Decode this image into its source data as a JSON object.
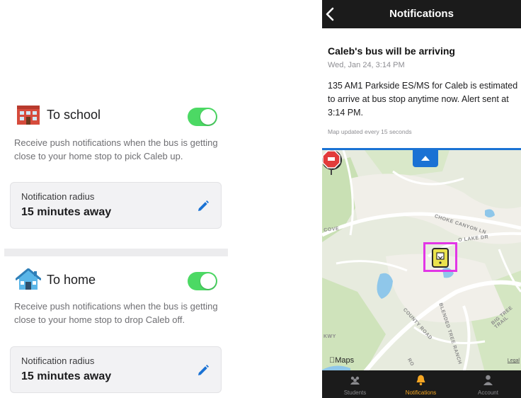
{
  "settings": {
    "to_school": {
      "title": "To school",
      "enabled": true,
      "description": "Receive push notifications when the bus is getting close to your home stop to pick Caleb up.",
      "radius_label": "Notification radius",
      "radius_value": "15 minutes away"
    },
    "to_home": {
      "title": "To home",
      "enabled": true,
      "description": "Receive push notifications when the bus is getting close to your home stop to drop Caleb off.",
      "radius_label": "Notification radius",
      "radius_value": "15 minutes away"
    }
  },
  "phone": {
    "nav_title": "Notifications",
    "alert": {
      "title": "Caleb's bus will be arriving",
      "date": "Wed, Jan 24, 3:14 PM",
      "body": "135 AM1 Parkside ES/MS for Caleb is estimated to arrive at bus stop anytime now. Alert sent at 3:14 PM.",
      "map_update": "Map updated every 15 seconds"
    },
    "map": {
      "labels": {
        "choke_canyon": "CHOKE CANYON LN",
        "lake_dr": "O LAKE DR",
        "cove": "COVE",
        "county_road": "COUNTY ROAD",
        "blended_tree": "BLENDED TREE RANCH",
        "big_tree": "BIG TREE TRAIL",
        "kwy": "KWY",
        "ro": "RO"
      },
      "brand": "Maps",
      "legal": "Legal"
    },
    "tabs": [
      {
        "label": "Students",
        "icon": "students-icon",
        "active": false
      },
      {
        "label": "Notifications",
        "icon": "bell-icon",
        "active": true
      },
      {
        "label": "Account",
        "icon": "account-icon",
        "active": false
      }
    ]
  },
  "colors": {
    "toggle_on": "#4cd964",
    "accent_blue": "#1a72d4",
    "tab_active": "#f5a623",
    "marker_highlight": "#e236e6"
  }
}
